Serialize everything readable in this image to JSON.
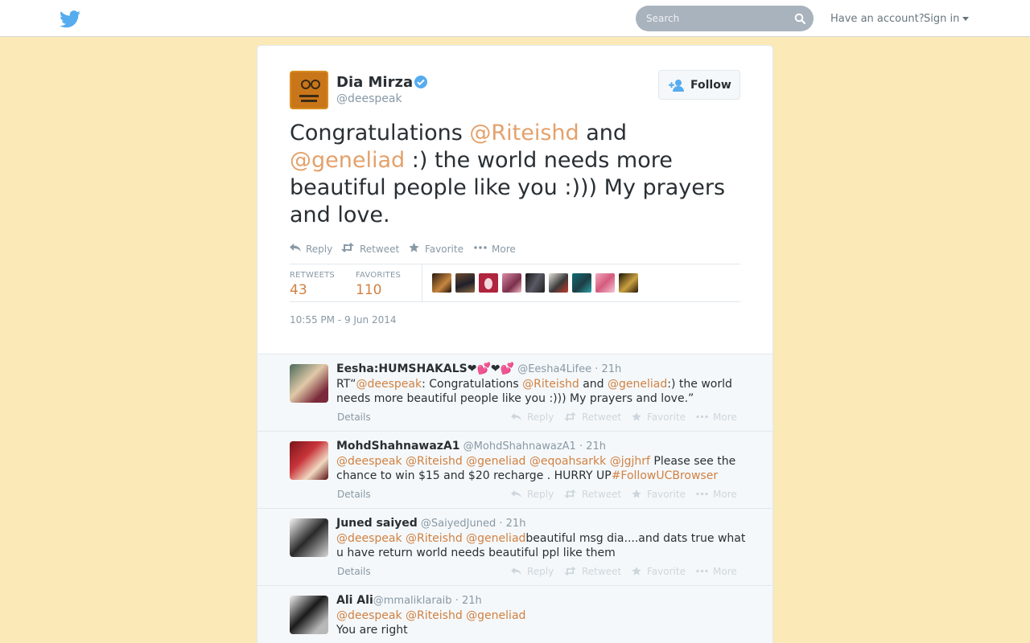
{
  "header": {
    "search_placeholder": "Search",
    "have_account": "Have an account?",
    "sign_in": "Sign in"
  },
  "colors": {
    "page_background": "#fbeab8",
    "link": "#d08142",
    "text_muted": "#8899a6",
    "twitter_blue": "#55acee",
    "search_bg": "#a9b3bd"
  },
  "tweet": {
    "author_name": "Dia Mirza",
    "author_handle": "@deespeak",
    "verified": true,
    "follow_label": "Follow",
    "text_parts": {
      "p1": "Congratulations ",
      "m1": "@Riteishd",
      "p2": " and",
      "m2": "@geneliad",
      "p3": " :) the world needs more beautiful people like you :))) My prayers and love."
    },
    "actions": {
      "reply": "Reply",
      "retweet": "Retweet",
      "favorite": "Favorite",
      "more": "More"
    },
    "stats": {
      "retweets_label": "RETWEETS",
      "retweets_value": "43",
      "favorites_label": "FAVORITES",
      "favorites_value": "110"
    },
    "timestamp": "10:55 PM - 9 Jun 2014"
  },
  "replies": [
    {
      "name": "Eesha:HUMSHAKALS❤💕❤💕",
      "handle": "@Eesha4Lifee",
      "time": "· 21h",
      "t0": "RT“",
      "t1": "@deespeak",
      "t2": ": Congratulations ",
      "t3": "@Riteishd",
      "t4": " and ",
      "t5": "@geneliad",
      "t6": ":) the world needs more beautiful people like you :))) My prayers and love.”",
      "details": "Details"
    },
    {
      "name": "MohdShahnawazA1",
      "handle": "@MohdShahnawazA1",
      "time": "· 21h",
      "t0": "@deespeak",
      "t1": "@Riteishd",
      "t2": "@geneliad",
      "t3": "@eqoahsarkk",
      "t4": "@jgjhrf",
      "t5": " Please see the chance to win $15 and $20 recharge . HURRY UP",
      "t6": "#FollowUCBrowser",
      "details": "Details"
    },
    {
      "name": "Juned saiyed",
      "handle": "@SaiyedJuned",
      "time": "· 21h",
      "t0": "@deespeak",
      "t1": "@Riteishd",
      "t2": "@geneliad",
      "t3": "beautiful msg dia....and dats true what u have return world needs beautiful ppl like them",
      "details": "Details"
    },
    {
      "name": "Ali Ali",
      "handle": "@mmaliklaraib",
      "time": "· 21h",
      "t0": "@deespeak",
      "t1": "@Riteishd",
      "t2": "@geneliad",
      "t3": "You are right"
    }
  ],
  "reply_actions": {
    "reply": "Reply",
    "retweet": "Retweet",
    "favorite": "Favorite",
    "more": "More"
  }
}
